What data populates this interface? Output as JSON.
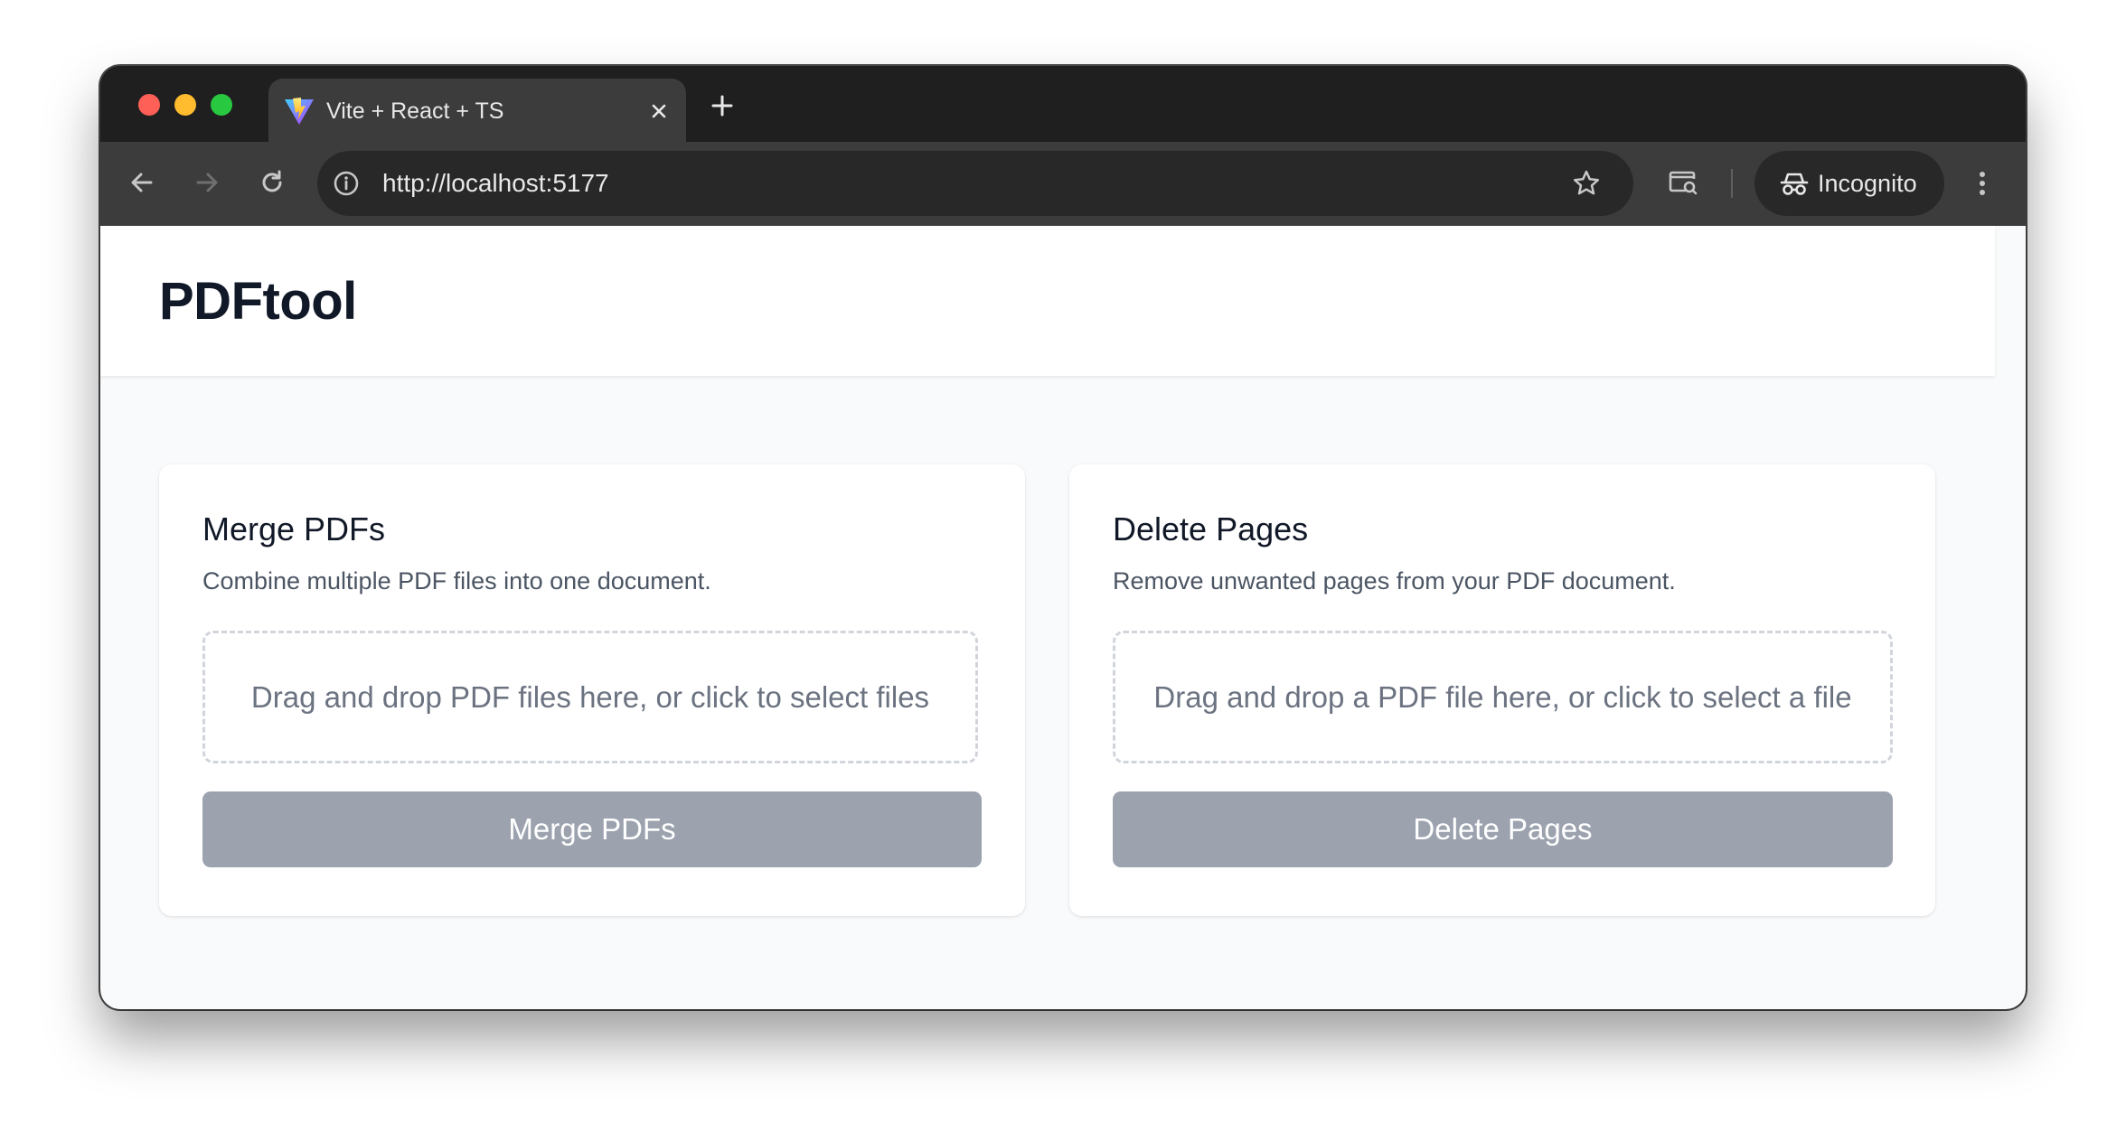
{
  "browser": {
    "tab": {
      "title": "Vite + React + TS"
    },
    "new_tab_icon": "plus-icon",
    "address_bar": {
      "url": "http://localhost:5177"
    },
    "profile": {
      "label": "Incognito"
    },
    "colors": {
      "close": "#fe5f57",
      "minimize": "#febc2e",
      "maximize": "#28c840"
    }
  },
  "app": {
    "title": "PDFtool",
    "cards": [
      {
        "title": "Merge PDFs",
        "description": "Combine multiple PDF files into one document.",
        "dropzone_text": "Drag and drop PDF files here, or click to select files",
        "button_label": "Merge PDFs"
      },
      {
        "title": "Delete Pages",
        "description": "Remove unwanted pages from your PDF document.",
        "dropzone_text": "Drag and drop a PDF file here, or click to select a file",
        "button_label": "Delete Pages"
      }
    ],
    "colors": {
      "button_disabled": "#9ca3af",
      "title_text": "#111827"
    }
  }
}
